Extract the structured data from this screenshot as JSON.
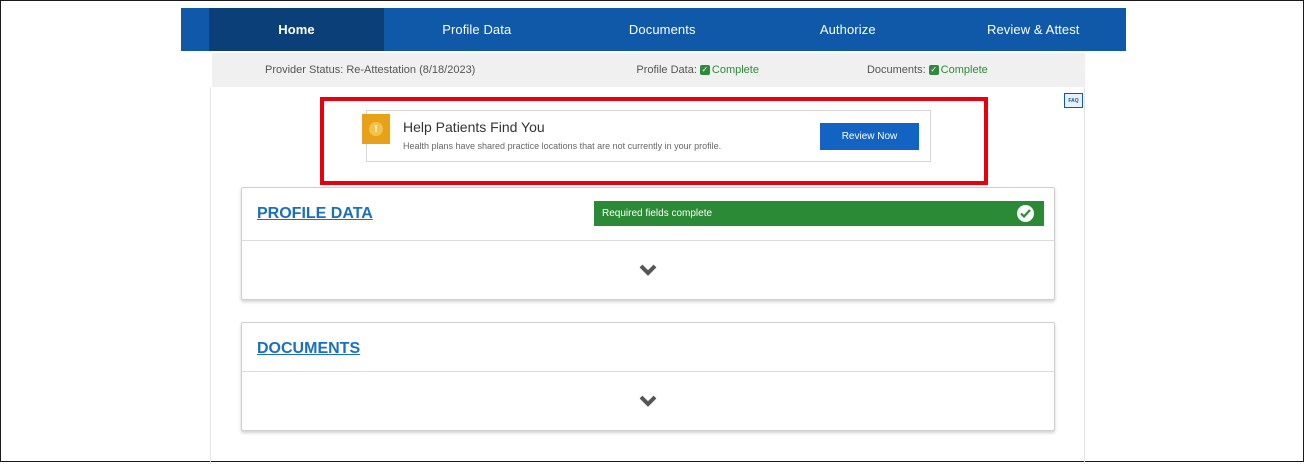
{
  "nav": {
    "tabs": [
      {
        "label": "Home",
        "active": true
      },
      {
        "label": "Profile Data"
      },
      {
        "label": "Documents"
      },
      {
        "label": "Authorize"
      },
      {
        "label": "Review & Attest"
      }
    ]
  },
  "status": {
    "provider_label": "Provider Status:",
    "provider_value": "Re-Attestation (8/18/2023)",
    "profile_label": "Profile Data:",
    "profile_value": "Complete",
    "documents_label": "Documents:",
    "documents_value": "Complete"
  },
  "faq": {
    "label": "FAQ"
  },
  "notice": {
    "title": "Help Patients Find You",
    "text": "Health plans have shared practice locations that are not currently in your profile.",
    "button": "Review Now"
  },
  "profile_card": {
    "title": "PROFILE DATA",
    "badge": "Required fields complete"
  },
  "documents_card": {
    "title": "DOCUMENTS"
  },
  "colors": {
    "nav": "#0f59a8",
    "nav_active": "#0b3f78",
    "success": "#2a8a35",
    "highlight": "#e8000d",
    "warning": "#e8a21a"
  }
}
